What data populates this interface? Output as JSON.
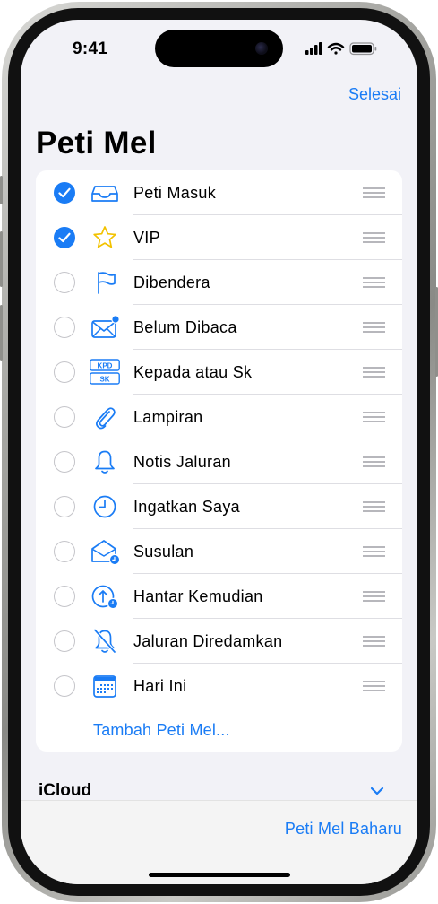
{
  "status_bar": {
    "time": "9:41"
  },
  "header": {
    "done_label": "Selesai",
    "title": "Peti Mel"
  },
  "mailboxes": [
    {
      "label": "Peti Masuk",
      "checked": true,
      "icon": "inbox-icon"
    },
    {
      "label": "VIP",
      "checked": true,
      "icon": "star-icon"
    },
    {
      "label": "Dibendera",
      "checked": false,
      "icon": "flag-icon"
    },
    {
      "label": "Belum Dibaca",
      "checked": false,
      "icon": "unread-envelope-icon"
    },
    {
      "label": "Kepada atau Sk",
      "checked": false,
      "icon": "to-cc-icon",
      "icon_text_top": "KPD",
      "icon_text_bottom": "SK"
    },
    {
      "label": "Lampiran",
      "checked": false,
      "icon": "paperclip-icon"
    },
    {
      "label": "Notis Jaluran",
      "checked": false,
      "icon": "bell-icon"
    },
    {
      "label": "Ingatkan Saya",
      "checked": false,
      "icon": "clock-icon"
    },
    {
      "label": "Susulan",
      "checked": false,
      "icon": "follow-up-envelope-icon"
    },
    {
      "label": "Hantar Kemudian",
      "checked": false,
      "icon": "send-later-icon"
    },
    {
      "label": "Jaluran Diredamkan",
      "checked": false,
      "icon": "muted-bell-icon"
    },
    {
      "label": "Hari Ini",
      "checked": false,
      "icon": "calendar-icon"
    }
  ],
  "add_mailbox_label": "Tambah Peti Mel...",
  "section": {
    "title": "iCloud"
  },
  "toolbar": {
    "new_mailbox_label": "Peti Mel Baharu"
  },
  "colors": {
    "accent": "#1a7cf5",
    "background": "#f2f2f7"
  }
}
